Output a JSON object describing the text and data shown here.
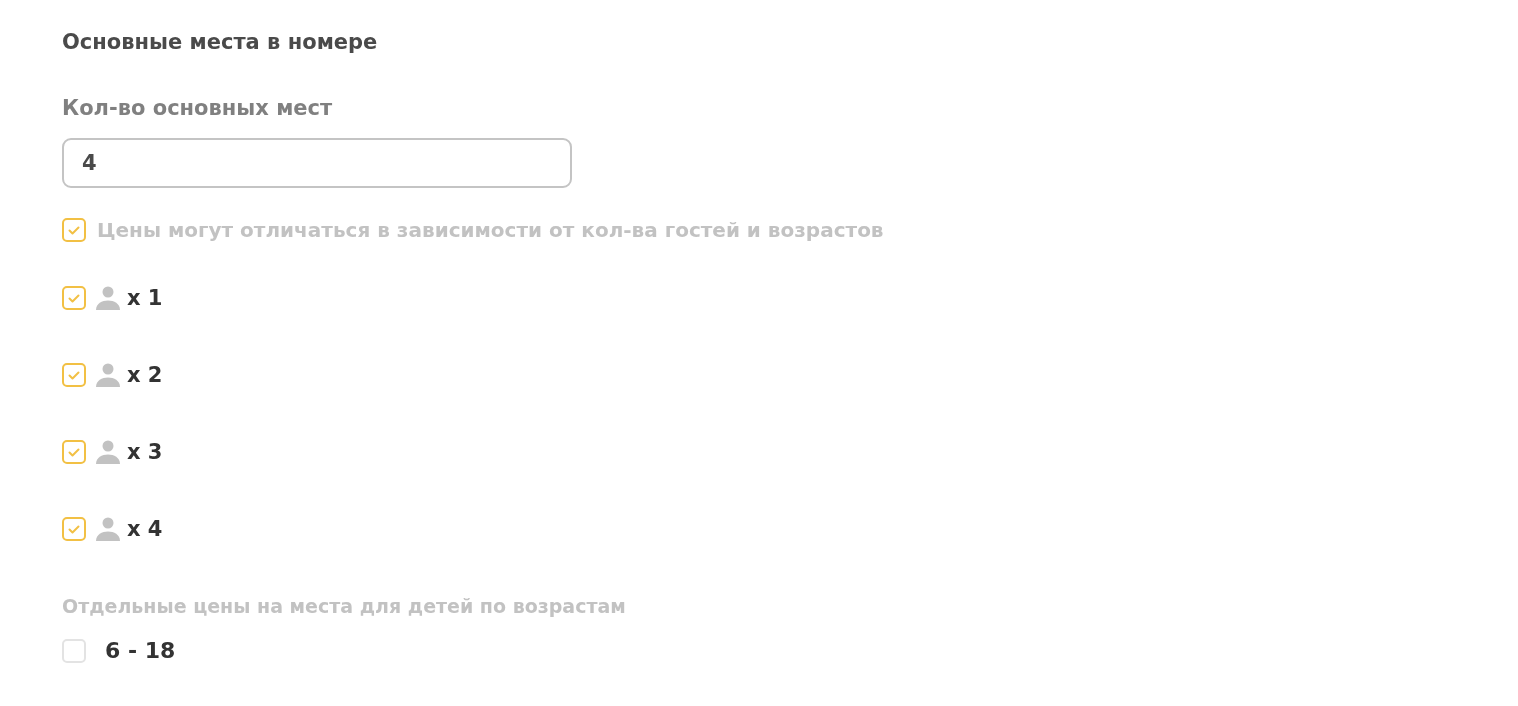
{
  "section_title": "Основные места в номере",
  "main_places": {
    "label": "Кол-во основных мест",
    "value": "4"
  },
  "price_varies": {
    "label": "Цены могут отличаться в зависимости от кол-ва гостей и возрастов",
    "checked": true
  },
  "guest_options": [
    {
      "label": "x 1",
      "checked": true
    },
    {
      "label": "x 2",
      "checked": true
    },
    {
      "label": "x 3",
      "checked": true
    },
    {
      "label": "x 4",
      "checked": true
    }
  ],
  "children_prices": {
    "title": "Отдельные цены на места для детей по возрастам",
    "age_ranges": [
      {
        "label": "6 - 18",
        "checked": false
      }
    ]
  }
}
